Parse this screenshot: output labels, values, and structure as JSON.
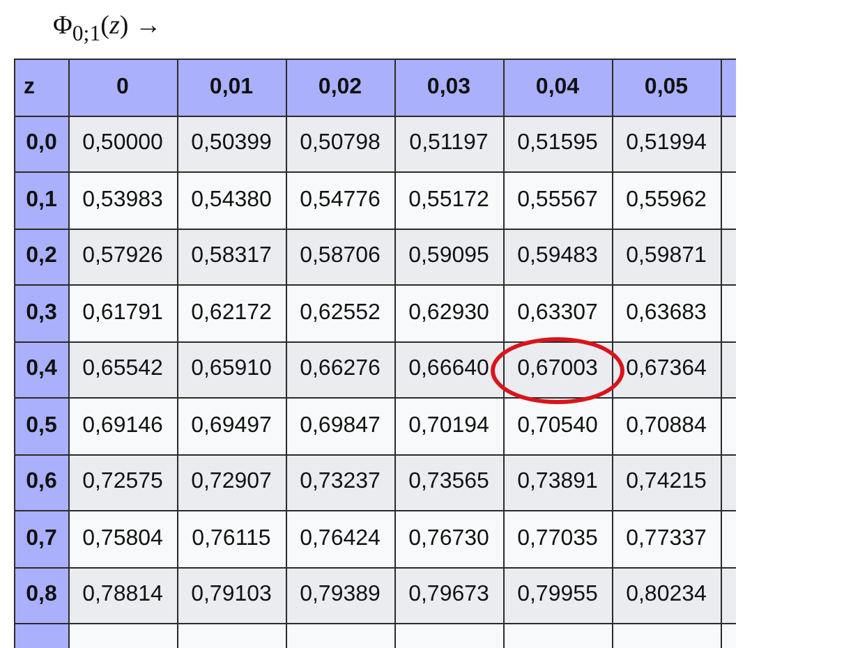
{
  "title": "Φ$_{0;1}$(*z*) →",
  "table": {
    "columns": [
      "z",
      "0",
      "0,01",
      "0,02",
      "0,03",
      "0,04",
      "0,05"
    ],
    "rows": [
      {
        "cells": [
          {
            "text": "0,0",
            "circled": false
          },
          {
            "text": "0,50000",
            "circled": false
          },
          {
            "text": "0,50399",
            "circled": false
          },
          {
            "text": "0,50798",
            "circled": false
          },
          {
            "text": "0,51197",
            "circled": false
          },
          {
            "text": "0,51595",
            "circled": false
          },
          {
            "text": "0,51994",
            "circled": false
          }
        ]
      },
      {
        "cells": [
          {
            "text": "0,1",
            "circled": false
          },
          {
            "text": "0,53983",
            "circled": false
          },
          {
            "text": "0,54380",
            "circled": false
          },
          {
            "text": "0,54776",
            "circled": false
          },
          {
            "text": "0,55172",
            "circled": false
          },
          {
            "text": "0,55567",
            "circled": false
          },
          {
            "text": "0,55962",
            "circled": false
          }
        ]
      },
      {
        "cells": [
          {
            "text": "0,2",
            "circled": false
          },
          {
            "text": "0,57926",
            "circled": false
          },
          {
            "text": "0,58317",
            "circled": false
          },
          {
            "text": "0,58706",
            "circled": false
          },
          {
            "text": "0,59095",
            "circled": false
          },
          {
            "text": "0,59483",
            "circled": false
          },
          {
            "text": "0,59871",
            "circled": false
          }
        ]
      },
      {
        "cells": [
          {
            "text": "0,3",
            "circled": false
          },
          {
            "text": "0,61791",
            "circled": false
          },
          {
            "text": "0,62172",
            "circled": false
          },
          {
            "text": "0,62552",
            "circled": false
          },
          {
            "text": "0,62930",
            "circled": false
          },
          {
            "text": "0,63307",
            "circled": false
          },
          {
            "text": "0,63683",
            "circled": false
          }
        ]
      },
      {
        "cells": [
          {
            "text": "0,4",
            "circled": false
          },
          {
            "text": "0,65542",
            "circled": false
          },
          {
            "text": "0,65910",
            "circled": false
          },
          {
            "text": "0,66276",
            "circled": false
          },
          {
            "text": "0,66640",
            "circled": false
          },
          {
            "text": "0,67003",
            "circled": true
          },
          {
            "text": "0,67364",
            "circled": false
          }
        ]
      },
      {
        "cells": [
          {
            "text": "0,5",
            "circled": false
          },
          {
            "text": "0,69146",
            "circled": false
          },
          {
            "text": "0,69497",
            "circled": false
          },
          {
            "text": "0,69847",
            "circled": false
          },
          {
            "text": "0,70194",
            "circled": false
          },
          {
            "text": "0,70540",
            "circled": false
          },
          {
            "text": "0,70884",
            "circled": false
          }
        ]
      },
      {
        "cells": [
          {
            "text": "0,6",
            "circled": false
          },
          {
            "text": "0,72575",
            "circled": false
          },
          {
            "text": "0,72907",
            "circled": false
          },
          {
            "text": "0,73237",
            "circled": false
          },
          {
            "text": "0,73565",
            "circled": false
          },
          {
            "text": "0,73891",
            "circled": false
          },
          {
            "text": "0,74215",
            "circled": false
          }
        ]
      },
      {
        "cells": [
          {
            "text": "0,7",
            "circled": false
          },
          {
            "text": "0,75804",
            "circled": false
          },
          {
            "text": "0,76115",
            "circled": false
          },
          {
            "text": "0,76424",
            "circled": false
          },
          {
            "text": "0,76730",
            "circled": false
          },
          {
            "text": "0,77035",
            "circled": false
          },
          {
            "text": "0,77337",
            "circled": false
          }
        ]
      },
      {
        "cells": [
          {
            "text": "0,8",
            "circled": false
          },
          {
            "text": "0,78814",
            "circled": false
          },
          {
            "text": "0,79103",
            "circled": false
          },
          {
            "text": "0,79389",
            "circled": false
          },
          {
            "text": "0,79673",
            "circled": false
          },
          {
            "text": "0,79955",
            "circled": false
          },
          {
            "text": "0,80234",
            "circled": false
          }
        ]
      }
    ]
  }
}
